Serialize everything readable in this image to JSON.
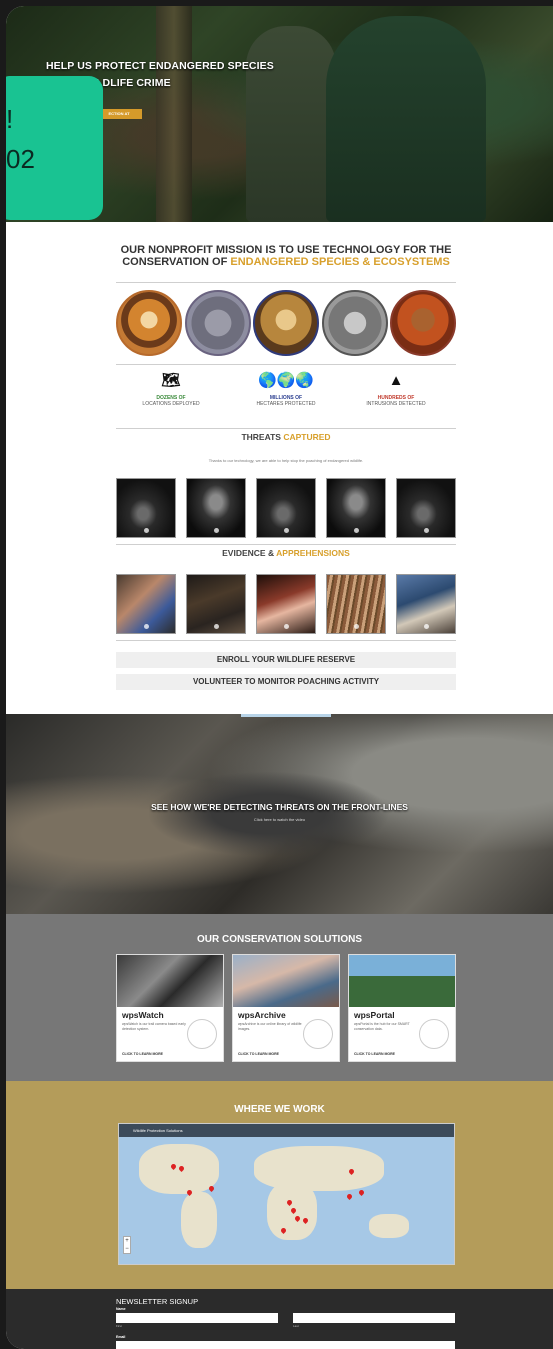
{
  "hero": {
    "title_line1": "HELP US PROTECT ENDANGERED SPECIES",
    "title_line2": "LDLIFE CRIME",
    "button": "ECTION AT"
  },
  "badge": {
    "line1": "!",
    "line2": "02"
  },
  "mission": {
    "title_part1": "OUR NONPROFIT MISSION IS TO USE TECHNOLOGY FOR THE",
    "title_part2": "CONSERVATION OF ",
    "title_highlight": "ENDANGERED SPECIES & ECOSYSTEMS"
  },
  "stats": [
    {
      "icon": "map-icon",
      "glyph": "🗺",
      "line1": "DOZENS OF",
      "line2": "LOCATIONS DEPLOYED"
    },
    {
      "icon": "globe-icon",
      "glyph": "🌎🌍🌏",
      "line1": "MILLIONS OF",
      "line2": "HECTARES PROTECTED"
    },
    {
      "icon": "warning-icon",
      "glyph": "▲",
      "line1": "HUNDREDS OF",
      "line2": "INTRUSIONS DETECTED"
    }
  ],
  "threats": {
    "title_part1": "THREATS ",
    "title_highlight": "CAPTURED",
    "description": "Thanks to our technology, we are able to help stop the poaching of endangered wildlife."
  },
  "evidence": {
    "title_part1": "EVIDENCE & ",
    "title_highlight": "APPREHENSIONS"
  },
  "cta": {
    "enroll": "ENROLL YOUR WILDLIFE RESERVE",
    "volunteer": "VOLUNTEER TO MONITOR POACHING ACTIVITY"
  },
  "video": {
    "title": "SEE HOW WE'RE DETECTING THREATS ON THE FRONT-LINES",
    "subtitle": "Click here to watch the video"
  },
  "solutions": {
    "title": "OUR CONSERVATION SOLUTIONS",
    "cards": [
      {
        "name": "wpsWatch",
        "desc": "wpsWatch is our trail camera based early detection system.",
        "more": "CLICK TO LEARN MORE"
      },
      {
        "name": "wpsArchive",
        "desc": "wpsArchive is our online library of wildlife images.",
        "more": "CLICK TO LEARN MORE"
      },
      {
        "name": "wpsPortal",
        "desc": "wpsPortal is the hub for our SMART conservation data.",
        "more": "CLICK TO LEARN MORE"
      }
    ]
  },
  "where": {
    "title": "WHERE WE WORK",
    "map_title": "Wildlife Protection Solutions"
  },
  "newsletter": {
    "title": "NEWSLETTER SIGNUP",
    "name_label": "Name",
    "first_label": "First",
    "last_label": "Last",
    "email_label": "Email"
  }
}
